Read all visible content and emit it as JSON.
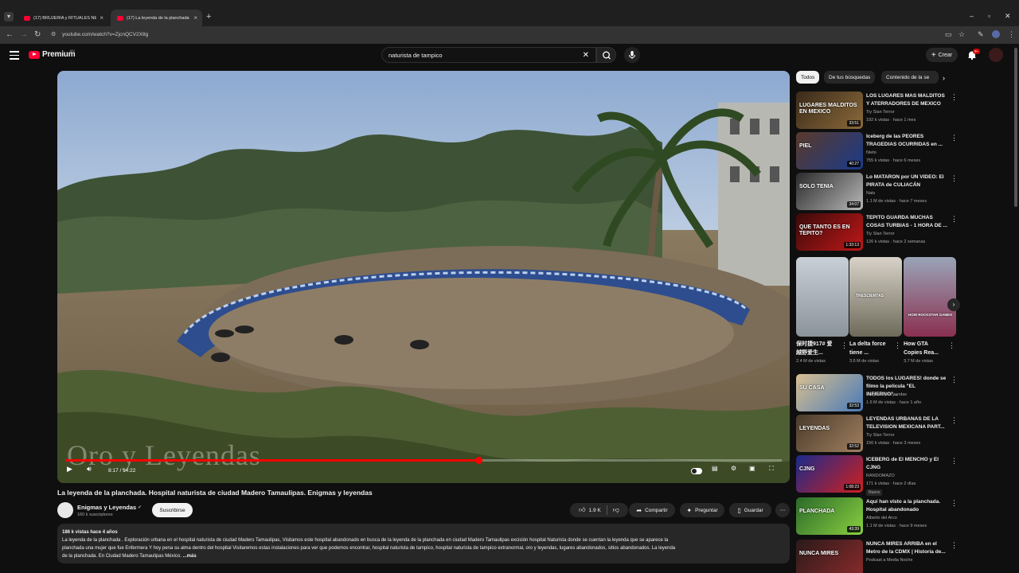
{
  "browser": {
    "tabs": [
      {
        "title": "(17) BRUJERIA y RITUALES NEG"
      },
      {
        "title": "(17) La leyenda de la planchada"
      }
    ],
    "url": "youtube.com/watch?v=ZjcnQCV2X8g"
  },
  "masthead": {
    "logo_word": "Premium",
    "country": "MX",
    "search_value": "naturista de tampico",
    "create_label": "Crear",
    "notif_count": "9+"
  },
  "player": {
    "watermark": "Oro y Leyendas",
    "time": "8:17 / 14:22",
    "progress": 0.577
  },
  "video": {
    "title": "La leyenda de la planchada. Hospital naturista de ciudad Madero Tamaulipas. Enigmas y leyendas",
    "channel": "Enigmas y Leyendas",
    "subscribers": "160 k suscriptores",
    "subscribe_label": "Suscribirse",
    "likes": "1.9 K",
    "share_label": "Compartir",
    "ask_label": "Preguntar",
    "save_label": "Guardar",
    "meta": "186 k vistas  hace 4 años",
    "description_line1": "La leyenda de la planchada . Exploración urbana en el hospital naturista de ciudad Madero Tamaulipas, Visitamos este hospital abandonado en busca de la leyenda de la planchada en ciudad Madero Tamaulipas excisión hospital Naturista donde se cuentan la leyenda que se aparece la",
    "description_line2": "planchada una mujer que fue Enfermera Y hoy pena su alma dentro del hospital Visitaremos estas instalaciones para ver que podemos encontrar,  hospital naturista de tampico,  hospital naturista de tampico extranormal, oro y leyendas,  lugares abandonados,  sitios abandonados. La leyenda",
    "description_line3": "de la planchada. En Ciudad Madero Tamaulipas México.",
    "more_label": "...más"
  },
  "sidebar": {
    "chips": [
      "Todos",
      "De tus búsquedas",
      "Contenido de la se"
    ],
    "items": [
      {
        "title": "LOS LUGARES MAS MALDITOS Y ATERRADORES DE MEXICO",
        "channel": "Tiy Slan Terror",
        "meta": "192 k vistas · hace 1 mes",
        "duration": "33:51",
        "label": "LUGARES MALDITOS EN MEXICO"
      },
      {
        "title": "Iceberg de las PEORES TRAGEDIAS OCURRIDAS en ...",
        "channel": "Nieto",
        "meta": "755 k vistas · hace 6 meses",
        "duration": "40:27",
        "label": "PIEL"
      },
      {
        "title": "Lo MATARON por UN VIDEO: El PIRATA de CULIACÁN",
        "channel": "Nats",
        "meta": "1.1 M de vistas · hace 7 meses",
        "duration": "34:07",
        "label": "SOLO TENIA"
      },
      {
        "title": "TEPITO GUARDA MUCHAS COSAS TURBIAS - 1 HORA DE ...",
        "channel": "Tiy Slan Terror",
        "meta": "126 k vistas · hace 2 semanas",
        "duration": "1:33:13",
        "label": "QUE TANTO ES EN TEPITO?"
      },
      {
        "title": "TODOS los LUGARES! donde se filmo la pelicula \"EL INFIERNO\"...",
        "channel": "Enigmas y Leyendas",
        "meta": "1.6 M de vistas · hace 1 año",
        "duration": "32:53",
        "label": "SU CASA"
      },
      {
        "title": "LEYENDAS URBANAS DE LA TELEVISION MEXICANA PART...",
        "channel": "Tiy Slan Terror",
        "meta": "156 k vistas · hace 3 meses",
        "duration": "32:52",
        "label": "LEYENDAS"
      },
      {
        "title": "ICEBERG de El MENCHO y El CJNG",
        "channel": "RANDOMAZO",
        "meta": "171 k vistas · hace 2 días",
        "duration": "1:08:23",
        "badge": "Nuevo",
        "label": "CJNG"
      },
      {
        "title": "Aquí han visto a la planchada. Hospital abandonado",
        "channel": "Alberto del Arco",
        "meta": "1.1 M de vistas · hace 9 meses",
        "duration": "43:39",
        "label": "PLANCHADA"
      },
      {
        "title": "NUNCA MIRES ARRIBA en el Metro de la CDMX | Historia de...",
        "channel": "Podcast a Media Noche",
        "meta": "",
        "duration": "",
        "label": "NUNCA MIRES"
      }
    ],
    "shorts": [
      {
        "title": "保时捷917# 爱越野爱生...",
        "views": "2.4 M de vistas"
      },
      {
        "title": "La delta force tiene ...",
        "views": "3.6 M de vistas",
        "label": "TRESCIENTAS"
      },
      {
        "title": "How GTA Copies Rea...",
        "views": "3.7 M de vistas",
        "label": "HOW ROCKSTAR GAMES"
      }
    ]
  }
}
